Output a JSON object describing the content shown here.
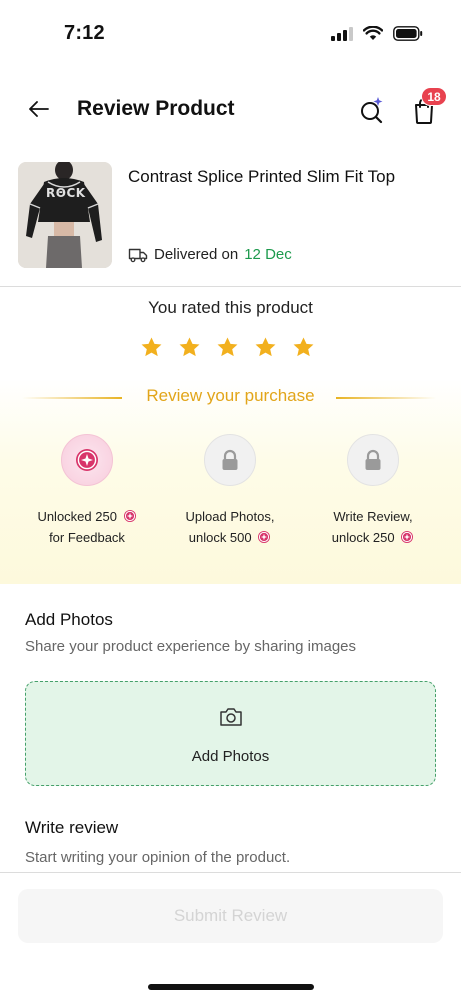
{
  "status_bar": {
    "time": "7:12"
  },
  "header": {
    "title": "Review Product",
    "cart_count": "18"
  },
  "product": {
    "name": "Contrast Splice Printed Slim Fit Top",
    "thumb_text": "RΘCK",
    "delivery_prefix": "Delivered on",
    "delivery_date": "12 Dec"
  },
  "rating": {
    "label": "You rated this product",
    "stars": 5,
    "max_stars": 5
  },
  "rewards": {
    "heading": "Review your purchase",
    "items": [
      {
        "line1": "Unlocked 250",
        "line2": "for Feedback",
        "state": "unlocked"
      },
      {
        "line1": "Upload Photos,",
        "line2": "unlock 500",
        "state": "locked"
      },
      {
        "line1": "Write Review,",
        "line2": "unlock 250",
        "state": "locked"
      }
    ]
  },
  "add_photos": {
    "title": "Add Photos",
    "subtitle": "Share your product experience by sharing images",
    "button_label": "Add Photos"
  },
  "write_review": {
    "title": "Write review",
    "placeholder": "Start writing your opinion of the product."
  },
  "submit": {
    "label": "Submit Review"
  },
  "colors": {
    "star": "#f2b01e",
    "accent_gold": "#e2a51a",
    "delivery_green": "#1d9a4d",
    "badge_red": "#e8424f",
    "upload_bg": "#e3f5e8",
    "upload_border": "#45a06a",
    "coin": "#d8346a"
  }
}
